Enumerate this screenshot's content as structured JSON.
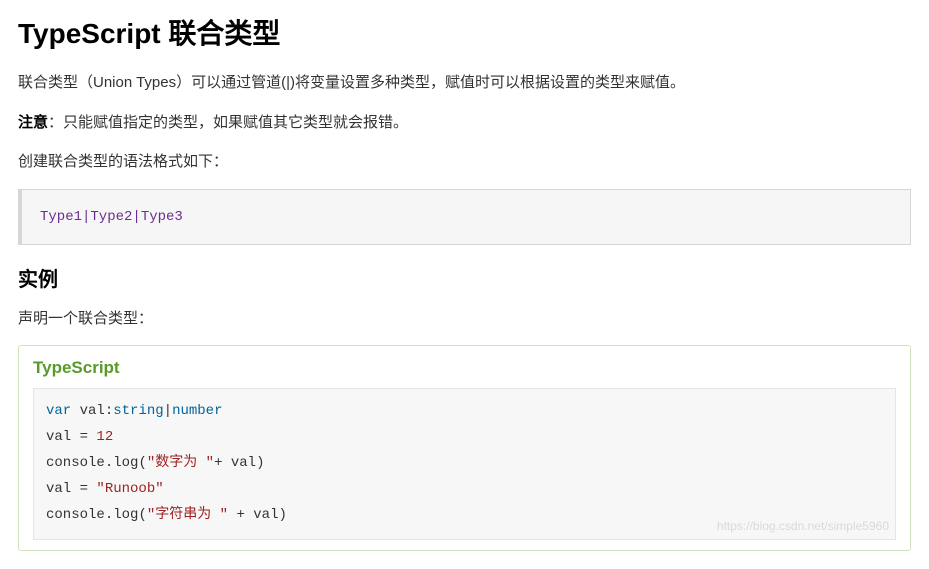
{
  "title": "TypeScript 联合类型",
  "paragraphs": {
    "intro": "联合类型（Union Types）可以通过管道(|)将变量设置多种类型，赋值时可以根据设置的类型来赋值。",
    "note_label": "注意",
    "note_text": "：只能赋值指定的类型，如果赋值其它类型就会报错。",
    "syntax": "创建联合类型的语法格式如下："
  },
  "syntax_code": "Type1|Type2|Type3",
  "example_heading": "实例",
  "example_intro": "声明一个联合类型：",
  "example_box_title": "TypeScript",
  "code": {
    "l1_var": "var",
    "l1_ident": " val",
    "l1_colon": ":",
    "l1_t1": "string",
    "l1_pipe": "|",
    "l1_t2": "number",
    "l2_lhs": "val ",
    "l2_eq": "= ",
    "l2_num": "12",
    "l3_a": "console",
    "l3_dot1": ".",
    "l3_b": "log",
    "l3_open": "(",
    "l3_str": "\"数字为 \"",
    "l3_plus": "+ val",
    "l3_close": ")",
    "l4_lhs": "val ",
    "l4_eq": "= ",
    "l4_str": "\"Runoob\"",
    "l5_a": "console",
    "l5_dot1": ".",
    "l5_b": "log",
    "l5_open": "(",
    "l5_str": "\"字符串为 \"",
    "l5_plus": " + val",
    "l5_close": ")"
  },
  "watermark": "https://blog.csdn.net/simple5960"
}
